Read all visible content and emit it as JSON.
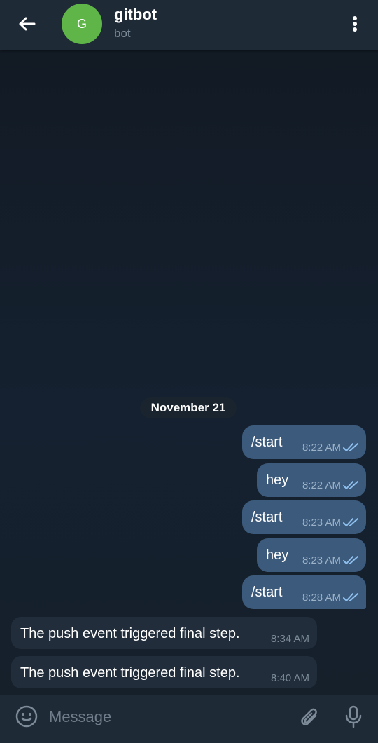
{
  "header": {
    "avatar_letter": "G",
    "title": "gitbot",
    "subtitle": "bot",
    "avatar_color": "#5fb548"
  },
  "chat": {
    "date_label": "November 21",
    "outgoing": [
      {
        "text": "/start",
        "time": "8:22 AM"
      },
      {
        "text": "hey",
        "time": "8:22 AM"
      },
      {
        "text": "/start",
        "time": "8:23 AM"
      },
      {
        "text": "hey",
        "time": "8:23 AM"
      },
      {
        "text": "/start",
        "time": "8:28 AM"
      }
    ],
    "incoming": [
      {
        "text": "The push event triggered final step.",
        "time": "8:34 AM"
      },
      {
        "text": "The push event triggered final step.",
        "time": "8:40 AM"
      }
    ]
  },
  "input": {
    "placeholder": "Message",
    "value": ""
  },
  "icons": {
    "back": "arrow-left-icon",
    "menu": "more-vertical-icon",
    "emoji": "emoji-icon",
    "attach": "paperclip-icon",
    "mic": "microphone-icon",
    "read": "double-check-icon"
  }
}
